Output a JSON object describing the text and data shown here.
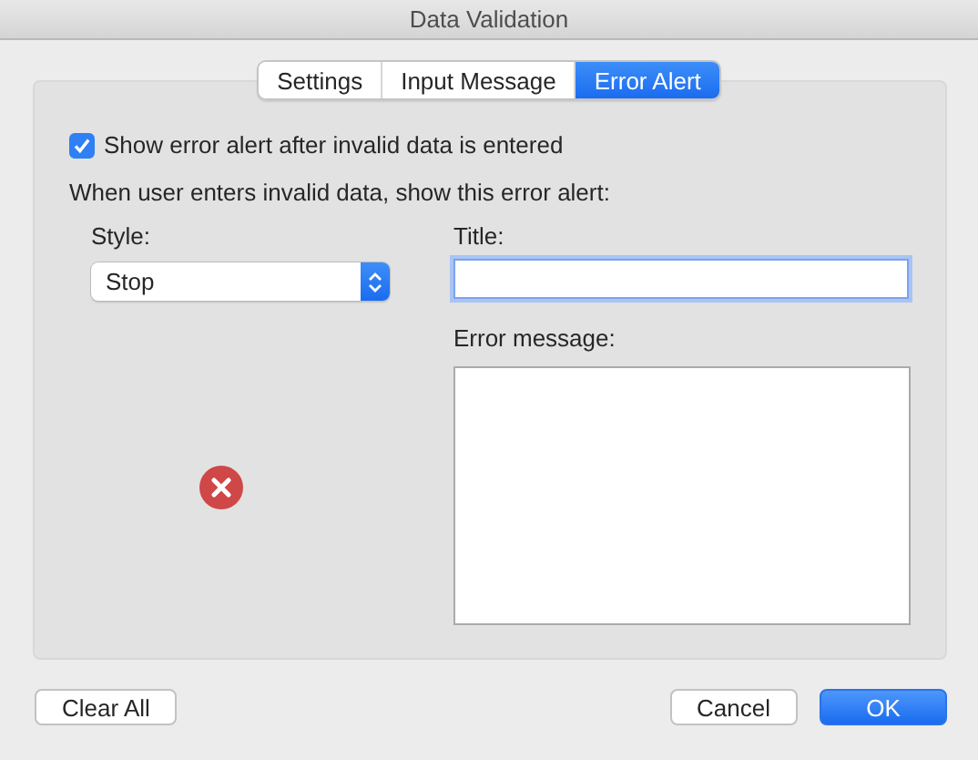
{
  "window": {
    "title": "Data Validation"
  },
  "tabs": [
    {
      "label": "Settings",
      "selected": false
    },
    {
      "label": "Input Message",
      "selected": false
    },
    {
      "label": "Error Alert",
      "selected": true
    }
  ],
  "show_alert": {
    "label": "Show error alert after invalid data is entered",
    "checked": true
  },
  "instruction": "When user enters invalid data, show this error alert:",
  "style": {
    "label": "Style:",
    "value": "Stop"
  },
  "alert_icon": {
    "kind": "stop"
  },
  "title_field": {
    "label": "Title:",
    "focused": true
  },
  "message_field": {
    "label": "Error message:"
  },
  "buttons": [
    {
      "label": "Clear All",
      "kind": "normal"
    },
    {
      "label": "Cancel",
      "kind": "normal"
    },
    {
      "label": "OK",
      "kind": "default"
    }
  ]
}
